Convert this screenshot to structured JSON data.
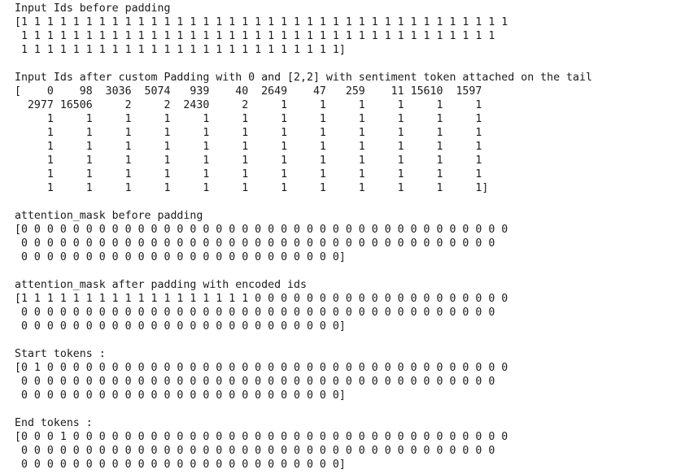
{
  "notebook_output": {
    "lines": [
      "Input Ids before padding",
      "[1 1 1 1 1 1 1 1 1 1 1 1 1 1 1 1 1 1 1 1 1 1 1 1 1 1 1 1 1 1 1 1 1 1 1 1 1 1",
      " 1 1 1 1 1 1 1 1 1 1 1 1 1 1 1 1 1 1 1 1 1 1 1 1 1 1 1 1 1 1 1 1 1 1 1 1 1",
      " 1 1 1 1 1 1 1 1 1 1 1 1 1 1 1 1 1 1 1 1 1 1 1 1 1]",
      "",
      "Input Ids after custom Padding with 0 and [2,2] with sentiment token attached on the tail",
      "[    0    98  3036  5074   939    40  2649    47   259    11 15610  1597",
      "  2977 16506     2     2  2430     2     1     1     1     1     1     1",
      "     1     1     1     1     1     1     1     1     1     1     1     1",
      "     1     1     1     1     1     1     1     1     1     1     1     1",
      "     1     1     1     1     1     1     1     1     1     1     1     1",
      "     1     1     1     1     1     1     1     1     1     1     1     1",
      "     1     1     1     1     1     1     1     1     1     1     1     1",
      "     1     1     1     1     1     1     1     1     1     1     1     1]",
      "",
      "attention_mask before padding",
      "[0 0 0 0 0 0 0 0 0 0 0 0 0 0 0 0 0 0 0 0 0 0 0 0 0 0 0 0 0 0 0 0 0 0 0 0 0 0",
      " 0 0 0 0 0 0 0 0 0 0 0 0 0 0 0 0 0 0 0 0 0 0 0 0 0 0 0 0 0 0 0 0 0 0 0 0 0",
      " 0 0 0 0 0 0 0 0 0 0 0 0 0 0 0 0 0 0 0 0 0 0 0 0 0]",
      "",
      "attention_mask after padding with encoded ids",
      "[1 1 1 1 1 1 1 1 1 1 1 1 1 1 1 1 1 1 0 0 0 0 0 0 0 0 0 0 0 0 0 0 0 0 0 0 0 0",
      " 0 0 0 0 0 0 0 0 0 0 0 0 0 0 0 0 0 0 0 0 0 0 0 0 0 0 0 0 0 0 0 0 0 0 0 0 0",
      " 0 0 0 0 0 0 0 0 0 0 0 0 0 0 0 0 0 0 0 0 0 0 0 0 0]",
      "",
      "Start tokens :",
      "[0 1 0 0 0 0 0 0 0 0 0 0 0 0 0 0 0 0 0 0 0 0 0 0 0 0 0 0 0 0 0 0 0 0 0 0 0 0",
      " 0 0 0 0 0 0 0 0 0 0 0 0 0 0 0 0 0 0 0 0 0 0 0 0 0 0 0 0 0 0 0 0 0 0 0 0 0",
      " 0 0 0 0 0 0 0 0 0 0 0 0 0 0 0 0 0 0 0 0 0 0 0 0 0]",
      "",
      "End tokens :",
      "[0 0 0 1 0 0 0 0 0 0 0 0 0 0 0 0 0 0 0 0 0 0 0 0 0 0 0 0 0 0 0 0 0 0 0 0 0 0",
      " 0 0 0 0 0 0 0 0 0 0 0 0 0 0 0 0 0 0 0 0 0 0 0 0 0 0 0 0 0 0 0 0 0 0 0 0 0",
      " 0 0 0 0 0 0 0 0 0 0 0 0 0 0 0 0 0 0 0 0 0 0 0 0 0]"
    ]
  }
}
